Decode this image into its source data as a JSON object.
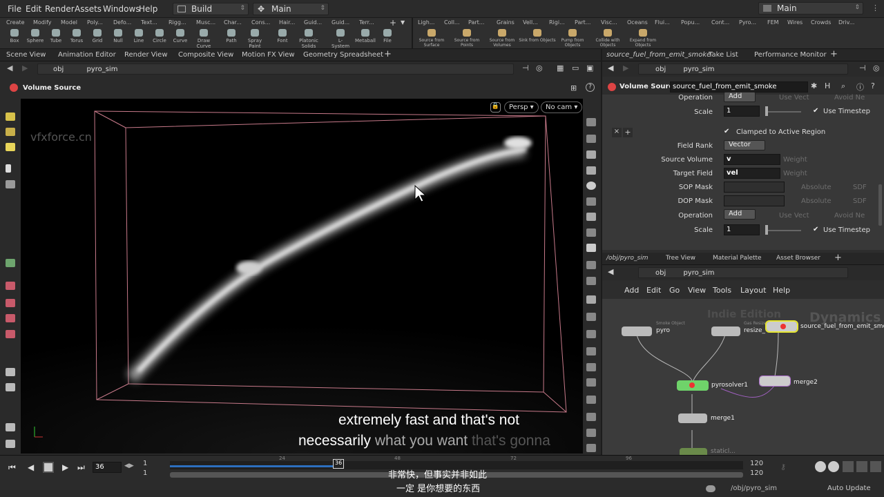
{
  "menubar": {
    "items": [
      "File",
      "Edit",
      "Render",
      "Assets",
      "Windows",
      "Help"
    ],
    "desktop": "Build",
    "network_context": "Main",
    "right_desktop": "Main"
  },
  "shelf": {
    "tabs": [
      "Create",
      "Modify",
      "Model",
      "Poly...",
      "Defo...",
      "Text...",
      "Rigg...",
      "Musc...",
      "Char...",
      "Cons...",
      "Hair...",
      "Guid...",
      "Guid...",
      "Terr..."
    ],
    "tools": [
      "Box",
      "Sphere",
      "Tube",
      "Torus",
      "Grid",
      "Null",
      "Line",
      "Circle",
      "Curve",
      "Draw Curve",
      "Path",
      "Spray Paint",
      "Font",
      "Platonic Solids",
      "L-System",
      "Metaball",
      "File"
    ],
    "right_tabs": [
      "Ligh...",
      "Coll...",
      "Part...",
      "Grains",
      "Vell...",
      "Rigi...",
      "Part...",
      "Visc...",
      "Oceans",
      "Flui...",
      "Popu...",
      "Cont...",
      "Pyro...",
      "FEM",
      "Wires",
      "Crowds",
      "Driv..."
    ],
    "right_tools": [
      "Source from Surface",
      "Source from Points",
      "Source from Volumes",
      "Sink from Objects",
      "Pump from Objects",
      "Collide with Objects",
      "Expand from Objects"
    ]
  },
  "left_pane": {
    "tabs": [
      "Scene View",
      "Animation Editor",
      "Render View",
      "Composite View",
      "Motion FX View",
      "Geometry Spreadsheet"
    ],
    "path_root": "obj",
    "path_node": "pyro_sim",
    "node_title": "Volume Source",
    "watermark": "vfxforce.cn",
    "camera": "Persp",
    "cam_select": "No cam"
  },
  "subtitles": {
    "en_line1": "extremely fast and that's not",
    "en_line2_a": "necessarily ",
    "en_line2_b": "what you want",
    "en_line2_c": " that's gonna",
    "zh_line1": "非常快，但事实并非如此",
    "zh_line2": "一定 是你想要的东西"
  },
  "right_pane": {
    "tabs": [
      "source_fuel_from_emit_smoke",
      "Take List",
      "Performance Monitor"
    ],
    "path_root": "obj",
    "path_node": "pyro_sim",
    "node_type": "Volume Source",
    "node_name": "source_fuel_from_emit_smoke",
    "params": {
      "operation_label": "Operation",
      "operation_top": "Add",
      "use_vect": "Use Vect",
      "avoid_ne": "Avoid Ne",
      "scale_label": "Scale",
      "scale_val": "1",
      "use_timestep": "Use Timestep",
      "clamped": "Clamped to Active Region",
      "field_rank_label": "Field Rank",
      "field_rank": "Vector",
      "source_volume_label": "Source Volume",
      "source_volume": "v",
      "weight": "Weight",
      "target_field_label": "Target Field",
      "target_field": "vel",
      "sop_mask": "SOP Mask",
      "dop_mask": "DOP Mask",
      "absolute": "Absolute",
      "sdf": "SDF",
      "operation2": "Add",
      "scale2": "1"
    }
  },
  "network_pane": {
    "tabs": [
      "/obj/pyro_sim",
      "Tree View",
      "Material Palette",
      "Asset Browser"
    ],
    "path_root": "obj",
    "path_node": "pyro_sim",
    "menu": [
      "Add",
      "Edit",
      "Go",
      "View",
      "Tools",
      "Layout",
      "Help"
    ],
    "edition": "Indie Edition",
    "context": "Dynamics",
    "nodes": {
      "pyro": "pyro",
      "pyro_type": "Smoke Object",
      "resize": "resize_",
      "resize_type": "Gas Resize",
      "source": "source_fuel_from_emit_smo",
      "solver": "pyrosolver1",
      "merge2": "merge2",
      "merge1": "merge1",
      "next": "staticl..."
    }
  },
  "timeline": {
    "frame": "36",
    "start": "1",
    "start2": "1",
    "end": "120",
    "end2": "120",
    "ticks": [
      "24",
      "36",
      "48",
      "72",
      "96"
    ],
    "current": 36,
    "range_start": 1,
    "range_end": 120,
    "path": "/obj/pyro_sim",
    "auto_update": "Auto Update"
  },
  "colors": {
    "accent": "#2c6fbf",
    "node_green": "#6fd36a",
    "node_yellow": "#e8e830",
    "node_purple": "#b070d0"
  }
}
